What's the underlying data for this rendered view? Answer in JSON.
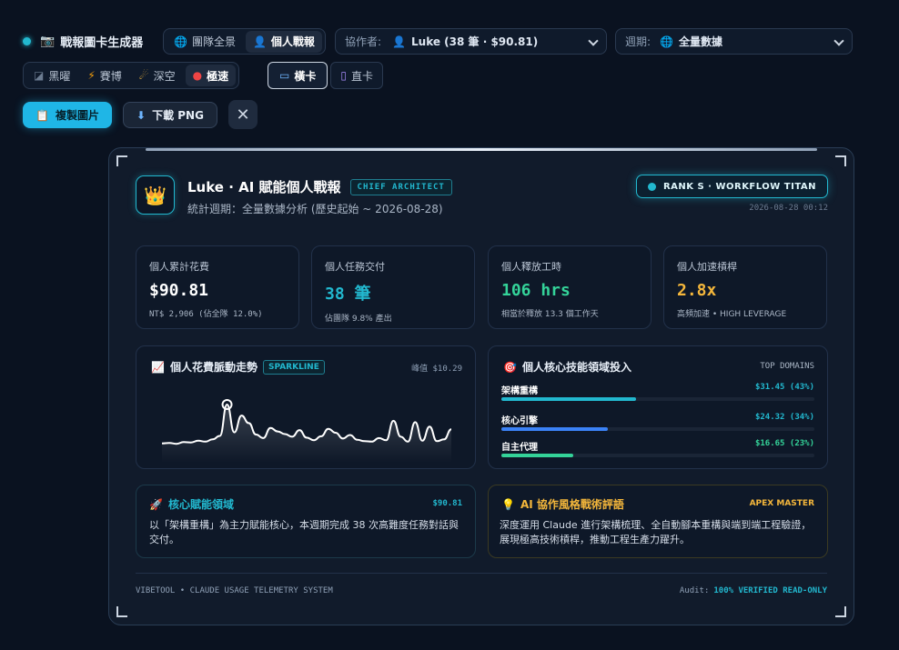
{
  "toolbar": {
    "app_title": "戰報圖卡生成器",
    "view_tabs": [
      {
        "label": "團隊全景",
        "active": false
      },
      {
        "label": "個人戰報",
        "active": true
      }
    ],
    "collaborator": {
      "label": "協作者:",
      "value": "Luke (38 筆 · $90.81)"
    },
    "period": {
      "label": "週期:",
      "value": "全量數據"
    },
    "themes": [
      {
        "label": "黑曜",
        "active": false
      },
      {
        "label": "賽博",
        "active": false
      },
      {
        "label": "深空",
        "active": false
      },
      {
        "label": "極速",
        "active": true
      }
    ],
    "layouts": [
      {
        "label": "橫卡",
        "active": true
      },
      {
        "label": "直卡",
        "active": false
      }
    ],
    "copy_label": "複製圖片",
    "download_label": "下載 PNG"
  },
  "card": {
    "title": "Luke · AI 賦能個人戰報",
    "role_badge": "CHIEF ARCHITECT",
    "subtitle": "統計週期：全量數據分析 (歷史起始 ~ 2026-08-28)",
    "rank": "RANK S · WORKFLOW TITAN",
    "timestamp": "2026-08-28 00:12",
    "stats": [
      {
        "label": "個人累計花費",
        "value": "$90.81",
        "sub": "NT$ 2,906 (佔全隊 12.0%)",
        "color": "#ffffff"
      },
      {
        "label": "個人任務交付",
        "value": "38 筆",
        "sub": "佔團隊 9.8% 產出",
        "color": "#22b8cf"
      },
      {
        "label": "個人釋放工時",
        "value": "106 hrs",
        "sub": "相當於釋放 13.3 個工作天",
        "color": "#34d399"
      },
      {
        "label": "個人加速槓桿",
        "value": "2.8x",
        "sub": "高頻加速 • HIGH LEVERAGE",
        "color": "#f5b73b"
      }
    ],
    "trend": {
      "title": "個人花費脈動走勢",
      "badge": "SPARKLINE",
      "peak": "峰值 $10.29"
    },
    "domains": {
      "title": "個人核心技能領域投入",
      "tag": "TOP DOMAINS",
      "items": [
        {
          "name": "架構重構",
          "value": "$31.45 (43%)",
          "pct": 0.43,
          "color": "#22b8cf"
        },
        {
          "name": "核心引擎",
          "value": "$24.32 (34%)",
          "pct": 0.34,
          "color": "#3b82f6"
        },
        {
          "name": "自主代理",
          "value": "$16.65 (23%)",
          "pct": 0.23,
          "color": "#34d399"
        }
      ]
    },
    "core": {
      "title": "核心賦能領域",
      "amount": "$90.81",
      "text": "以「架構重構」為主力賦能核心，本週期完成 38 次高難度任務對話與交付。"
    },
    "style": {
      "title": "AI 協作風格戰術評語",
      "badge": "APEX MASTER",
      "text": "深度運用 Claude 進行架構梳理、全自動腳本重構與端到端工程驗證，展現極高技術槓桿，推動工程生產力躍升。"
    },
    "footer_left": "VIBETOOL • CLAUDE USAGE TELEMETRY SYSTEM",
    "audit_label": "Audit:",
    "audit_value": "100% VERIFIED READ-ONLY"
  },
  "sparkline": [
    1.5,
    1.6,
    1.4,
    1.8,
    1.7,
    2.1,
    1.9,
    2.4,
    3.2,
    10.29,
    4.0,
    7.8,
    6.1,
    3.5,
    2.7,
    5.0,
    4.2,
    3.6,
    3.0,
    4.5,
    2.8,
    2.2,
    3.1,
    4.8,
    3.9,
    2.6,
    3.4,
    2.3,
    2.0,
    1.9,
    2.7,
    2.2,
    6.6,
    3.0,
    1.9,
    6.3,
    2.1,
    5.3,
    2.0,
    2.4,
    4.7
  ]
}
